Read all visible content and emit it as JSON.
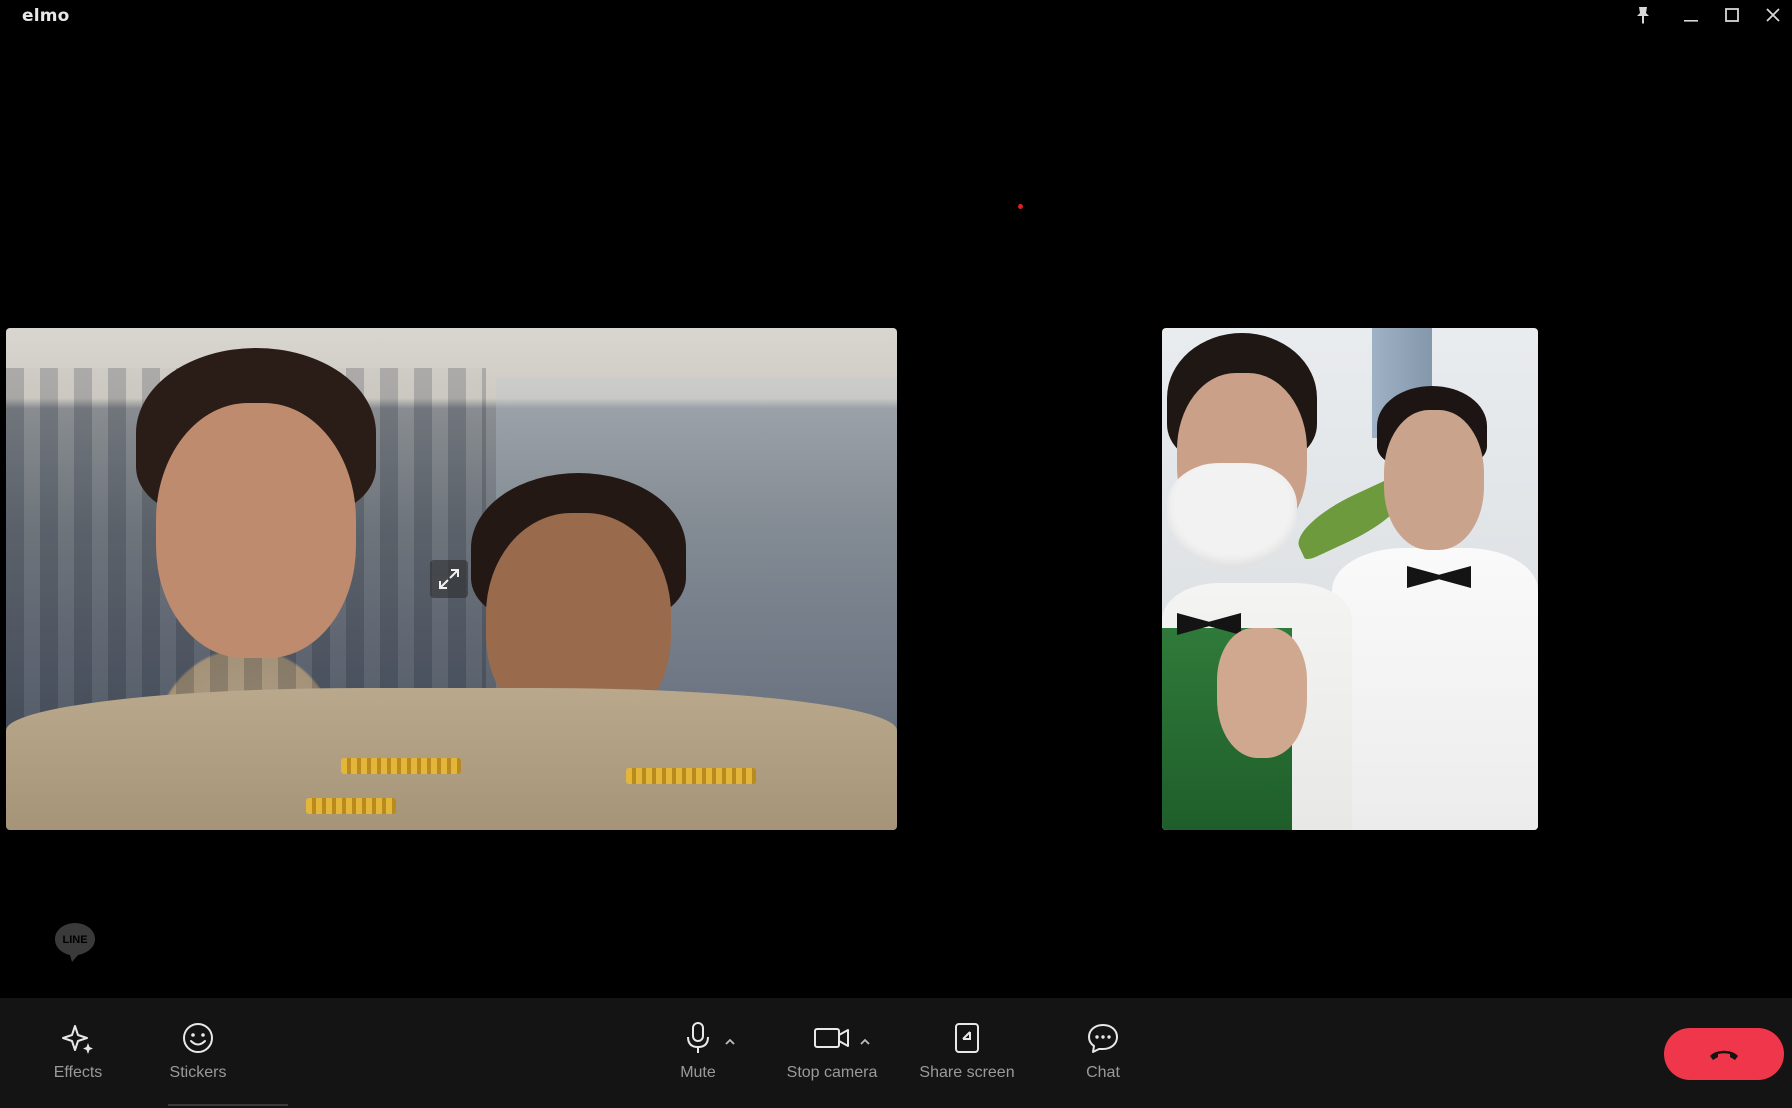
{
  "app": {
    "title": "elmo"
  },
  "window_controls": {
    "pin": "pin-icon",
    "minimize": "minimize-icon",
    "maximize": "maximize-icon",
    "close": "close-icon"
  },
  "stage": {
    "recording_indicator_color": "#e02020",
    "tiles": [
      {
        "id": "participant-video-1",
        "expand_icon": "expand-icon"
      },
      {
        "id": "participant-video-2"
      }
    ],
    "brand_badge": "LINE"
  },
  "toolbar": {
    "effects_label": "Effects",
    "stickers_label": "Stickers",
    "mute_label": "Mute",
    "stop_camera_label": "Stop camera",
    "share_screen_label": "Share screen",
    "chat_label": "Chat",
    "end_call_color": "#f0364a"
  }
}
